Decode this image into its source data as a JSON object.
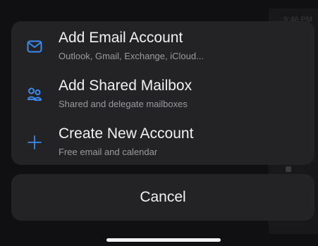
{
  "background": {
    "time_text": "9:46 PM"
  },
  "menu": {
    "items": [
      {
        "icon": "envelope-icon",
        "title": "Add Email Account",
        "subtitle": "Outlook, Gmail, Exchange, iCloud..."
      },
      {
        "icon": "shared-people-icon",
        "title": "Add Shared Mailbox",
        "subtitle": "Shared and delegate mailboxes"
      },
      {
        "icon": "plus-icon",
        "title": "Create New Account",
        "subtitle": "Free email and calendar"
      }
    ]
  },
  "cancel_label": "Cancel",
  "colors": {
    "accent": "#3b8bf0",
    "sheet": "#232325",
    "text": "#f2f2f4",
    "subtext": "#9a9aa0"
  }
}
